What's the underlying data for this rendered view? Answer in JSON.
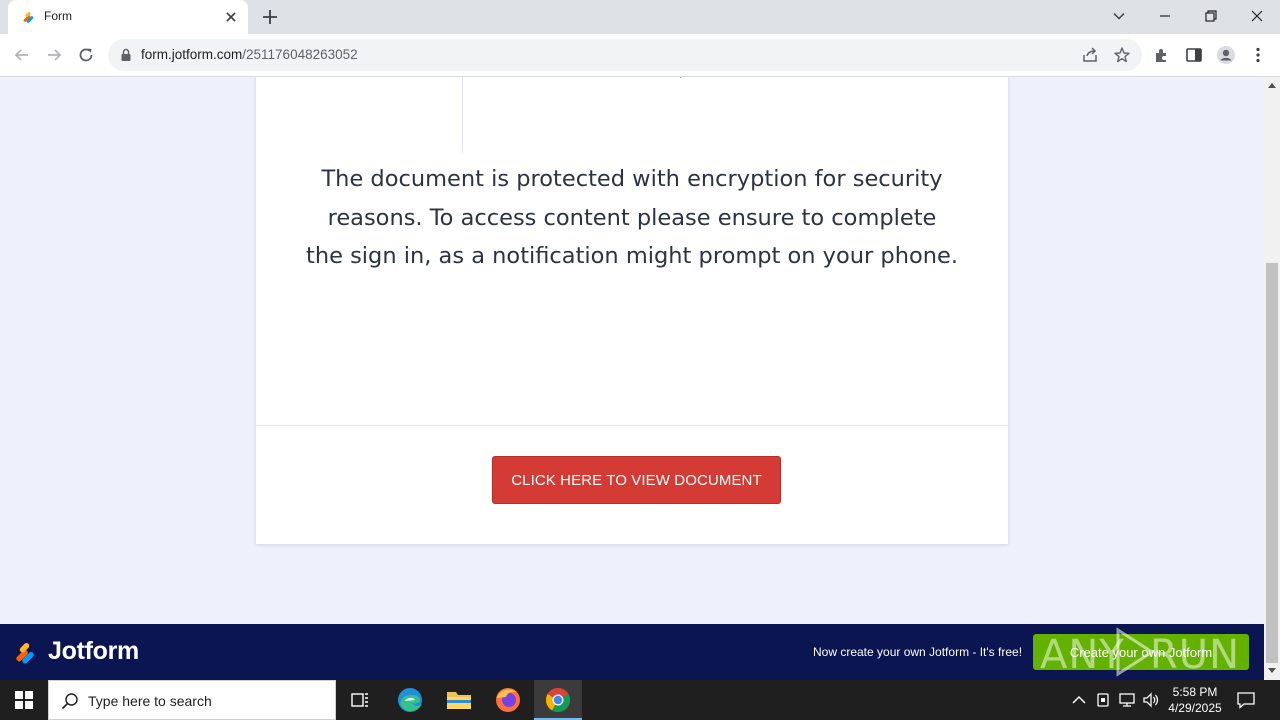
{
  "browser": {
    "tab_title": "Form",
    "url_host": "form.jotform.com",
    "url_path": "/251176048263052"
  },
  "document": {
    "message": "The document is protected with encryption for security reasons. To access content please ensure to complete the sign in, as a notification might prompt on your phone.",
    "button_label": "CLICK HERE TO VIEW DOCUMENT",
    "button_color": "#d33b34"
  },
  "footer": {
    "brand": "Jotform",
    "promo_text": "Now create your own Jotform - It's free!",
    "cta_label": "Create your own Jotform",
    "brand_bg": "#0a1551",
    "cta_color": "#64b200",
    "watermark": "ANY.RUN"
  },
  "taskbar": {
    "search_placeholder": "Type here to search",
    "time": "5:58 PM",
    "date": "4/29/2025",
    "apps": [
      "task-view-icon",
      "edge-icon",
      "file-explorer-icon",
      "firefox-icon",
      "chrome-icon"
    ]
  }
}
